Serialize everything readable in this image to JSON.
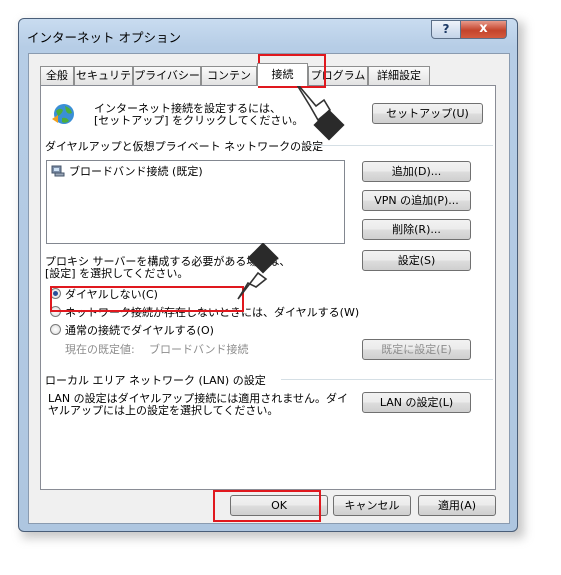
{
  "window": {
    "title": "インターネット オプション",
    "help_label": "?",
    "close_label": "x"
  },
  "tabs": [
    "全般",
    "セキュリティ",
    "プライバシー",
    "コンテンツ",
    "接続",
    "プログラム",
    "詳細設定"
  ],
  "active_tab": "接続",
  "setup": {
    "text_line1": "インターネット接続を設定するには、",
    "text_line2": "[セットアップ] をクリックしてください。",
    "button": "セットアップ(U)"
  },
  "dialup": {
    "section_label": "ダイヤルアップと仮想プライベート ネットワークの設定",
    "connections": [
      "ブロードバンド接続 (既定)"
    ],
    "add_button": "追加(D)...",
    "add_vpn_button": "VPN の追加(P)...",
    "remove_button": "削除(R)...",
    "settings_button": "設定(S)",
    "proxy_text_line1": "プロキシ サーバーを構成する必要がある場合は、",
    "proxy_text_line2": "[設定] を選択してください。",
    "options": [
      {
        "label": "ダイヤルしない(C)",
        "selected": true
      },
      {
        "label": "ネットワーク接続が存在しないときには、ダイヤルする(W)",
        "selected": false
      },
      {
        "label": "通常の接続でダイヤルする(O)",
        "selected": false
      }
    ],
    "current_default_label": "現在の既定値:",
    "current_default_value": "ブロードバンド接続",
    "set_default_button": "既定に設定(E)"
  },
  "lan": {
    "section_label": "ローカル エリア ネットワーク (LAN) の設定",
    "text_line1": "LAN の設定はダイヤルアップ接続には適用されません。ダイ",
    "text_line2": "ヤルアップには上の設定を選択してください。",
    "button": "LAN の設定(L)"
  },
  "footer": {
    "ok": "OK",
    "cancel": "キャンセル",
    "apply": "適用(A)"
  },
  "colors": {
    "highlight_box": "#e0181e",
    "title_bar": "#b6cde6",
    "radio_dot": "#2a4e9a"
  }
}
